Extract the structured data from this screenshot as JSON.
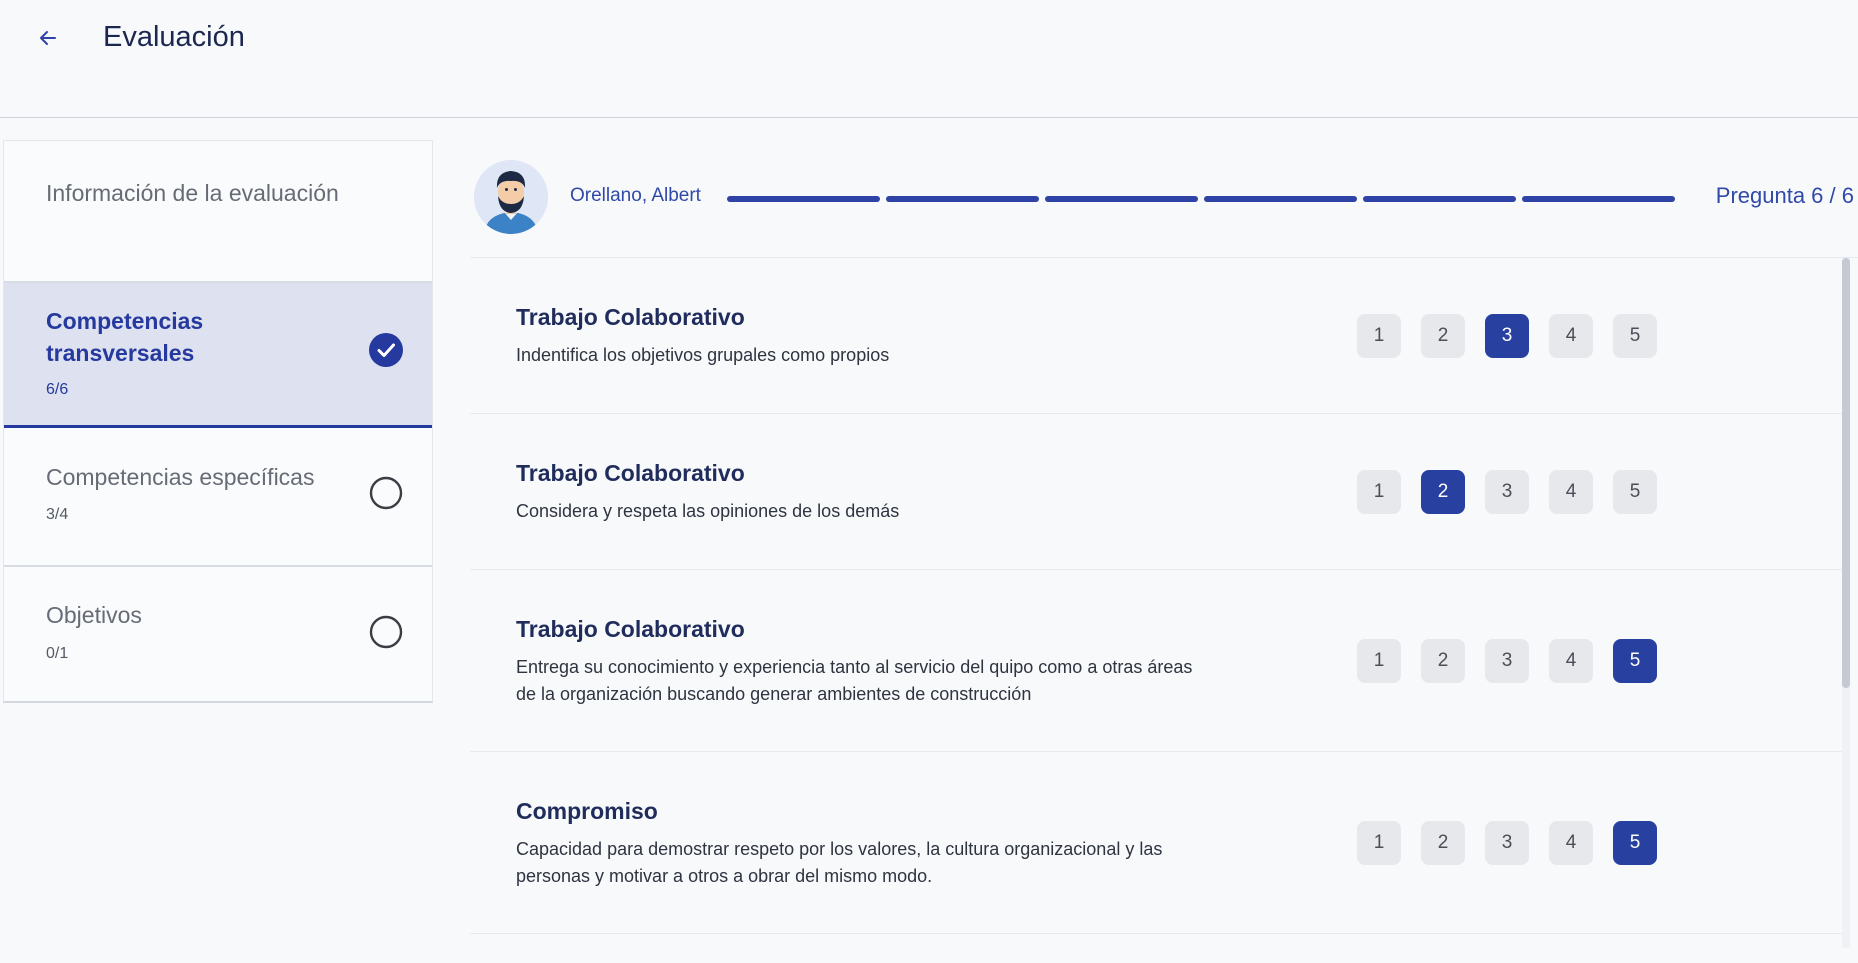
{
  "header": {
    "title": "Evaluación"
  },
  "sidebar": {
    "items": [
      {
        "label": "Información de la evaluación",
        "count": "",
        "status": "none"
      },
      {
        "label": "Competencias transversales",
        "count": "6/6",
        "status": "complete"
      },
      {
        "label": "Competencias específicas",
        "count": "3/4",
        "status": "incomplete"
      },
      {
        "label": "Objetivos",
        "count": "0/1",
        "status": "incomplete"
      }
    ]
  },
  "participant": {
    "name": "Orellano, Albert",
    "question_counter": "Pregunta 6 / 6",
    "progress": {
      "completed": 6,
      "total": 6
    }
  },
  "questions": [
    {
      "title": "Trabajo Colaborativo",
      "description": "Indentifica los objetivos grupales como propios",
      "selected": 3
    },
    {
      "title": "Trabajo Colaborativo",
      "description": "Considera y respeta las opiniones de los demás",
      "selected": 2
    },
    {
      "title": "Trabajo Colaborativo",
      "description": "Entrega su conocimiento y experiencia tanto al servicio del quipo como a otras áreas de la organización buscando generar ambientes de construcción",
      "selected": 5
    },
    {
      "title": "Compromiso",
      "description": "Capacidad para demostrar respeto por los valores, la cultura organizacional y las personas y motivar a otros a obrar del mismo modo.",
      "selected": 5
    }
  ],
  "scale_options": [
    "1",
    "2",
    "3",
    "4",
    "5"
  ],
  "colors": {
    "accent": "#28409f",
    "active_bg": "#dde1f0",
    "option_bg": "#e7e8eb"
  },
  "icons": {
    "back": "arrow-left-icon",
    "complete": "check-circle-icon",
    "incomplete": "empty-circle-icon"
  }
}
